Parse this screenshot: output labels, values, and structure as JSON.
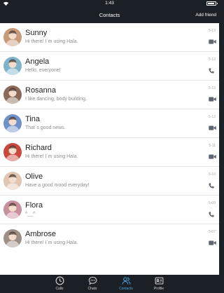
{
  "status_bar": {
    "time": "1:43",
    "battery_level": 0.85
  },
  "nav": {
    "title": "Contacts",
    "add_friend_label": "Add friend"
  },
  "contacts": [
    {
      "name": "Sunny",
      "message": "Hi there! I`m using Hala.",
      "date": "5-13",
      "action": "video-icon",
      "avatar_color": "#c79a7a"
    },
    {
      "name": "Angela",
      "message": "Hello, everyone!",
      "date": "5-13",
      "action": "phone-icon",
      "avatar_color": "#7fb3c9"
    },
    {
      "name": "Rosanna",
      "message": "I like dancing, body building.",
      "date": "5-13",
      "action": "video-icon",
      "avatar_color": "#8a6a58"
    },
    {
      "name": "Tina",
      "message": "That`s good news.",
      "date": "5-12",
      "action": "video-icon",
      "avatar_color": "#6f91c9"
    },
    {
      "name": "Richard",
      "message": "Hi there! I`m using Hala.",
      "date": "5-11",
      "action": "video-icon",
      "avatar_color": "#c9473d"
    },
    {
      "name": "Olive",
      "message": "Have a good mood everyday!",
      "date": "5-10",
      "action": "phone-icon",
      "avatar_color": "#e0c6b2"
    },
    {
      "name": "Flora",
      "message": "^__^",
      "date": "5-09",
      "action": "phone-icon",
      "avatar_color": "#c88f9c"
    },
    {
      "name": "Ambrose",
      "message": "Hi there! I`m using Hala.",
      "date": "5-07",
      "action": "video-icon",
      "avatar_color": "#9d8f86"
    }
  ],
  "tabs": [
    {
      "label": "Calls",
      "icon": "clock-icon",
      "active": false
    },
    {
      "label": "Chats",
      "icon": "chat-icon",
      "active": false
    },
    {
      "label": "Contacts",
      "icon": "contacts-icon",
      "active": true
    },
    {
      "label": "Profile",
      "icon": "profile-icon",
      "active": false
    }
  ],
  "colors": {
    "bar_background": "#1b1f26",
    "accent": "#4ea6e0",
    "icon_gray": "#5f6670"
  }
}
